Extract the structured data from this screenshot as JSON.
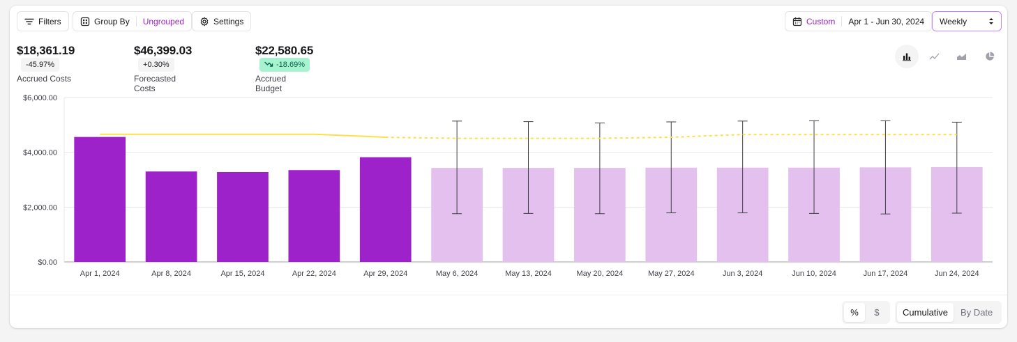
{
  "toolbar": {
    "filters_label": "Filters",
    "group_by_label": "Group By",
    "group_by_value": "Ungrouped",
    "settings_label": "Settings",
    "date_mode": "Custom",
    "date_range": "Apr 1 - Jun 30, 2024",
    "granularity": "Weekly"
  },
  "kpis": [
    {
      "value": "$18,361.19",
      "change": "-45.97%",
      "label": "Accrued Costs"
    },
    {
      "value": "$46,399.03",
      "change": "+0.30%",
      "label": "Forecasted Costs"
    },
    {
      "value": "$22,580.65",
      "change": "-18.69%",
      "label": "Accrued Budget"
    }
  ],
  "view_options": [
    "bar-chart-icon",
    "line-chart-icon",
    "area-chart-icon",
    "pie-chart-icon"
  ],
  "footer": {
    "unit_percent": "%",
    "unit_dollar": "$",
    "mode_cumulative": "Cumulative",
    "mode_by_date": "By Date"
  },
  "colors": {
    "actual": "#9d22c9",
    "forecast": "#e4c0ef",
    "budget": "#fde047",
    "accent": "#9d22c9"
  },
  "chart_data": {
    "type": "bar",
    "categories": [
      "Apr 1, 2024",
      "Apr 8, 2024",
      "Apr 15, 2024",
      "Apr 22, 2024",
      "Apr 29, 2024",
      "May 6, 2024",
      "May 13, 2024",
      "May 20, 2024",
      "May 27, 2024",
      "Jun 3, 2024",
      "Jun 10, 2024",
      "Jun 17, 2024",
      "Jun 24, 2024"
    ],
    "series": [
      {
        "type": "bar",
        "values": [
          4560,
          3300,
          3280,
          3350,
          3820,
          3430,
          3430,
          3430,
          3440,
          3440,
          3440,
          3450,
          3460
        ],
        "forecast_from_index": 5
      },
      {
        "type": "error",
        "low": [
          null,
          null,
          null,
          null,
          null,
          1760,
          1770,
          1760,
          1790,
          1790,
          1770,
          1750,
          1780
        ],
        "high": [
          null,
          null,
          null,
          null,
          null,
          5140,
          5120,
          5070,
          5110,
          5140,
          5150,
          5150,
          5100
        ]
      },
      {
        "type": "line",
        "values": [
          4660,
          4660,
          4660,
          4660,
          4550,
          4510,
          4510,
          4510,
          4550,
          4650,
          4650,
          4650,
          4650
        ],
        "dashed_from_index": 4
      }
    ],
    "yticks": [
      "$0.00",
      "$2,000.00",
      "$4,000.00",
      "$6,000.00"
    ],
    "ylim": [
      0,
      6000
    ],
    "grid": true
  }
}
